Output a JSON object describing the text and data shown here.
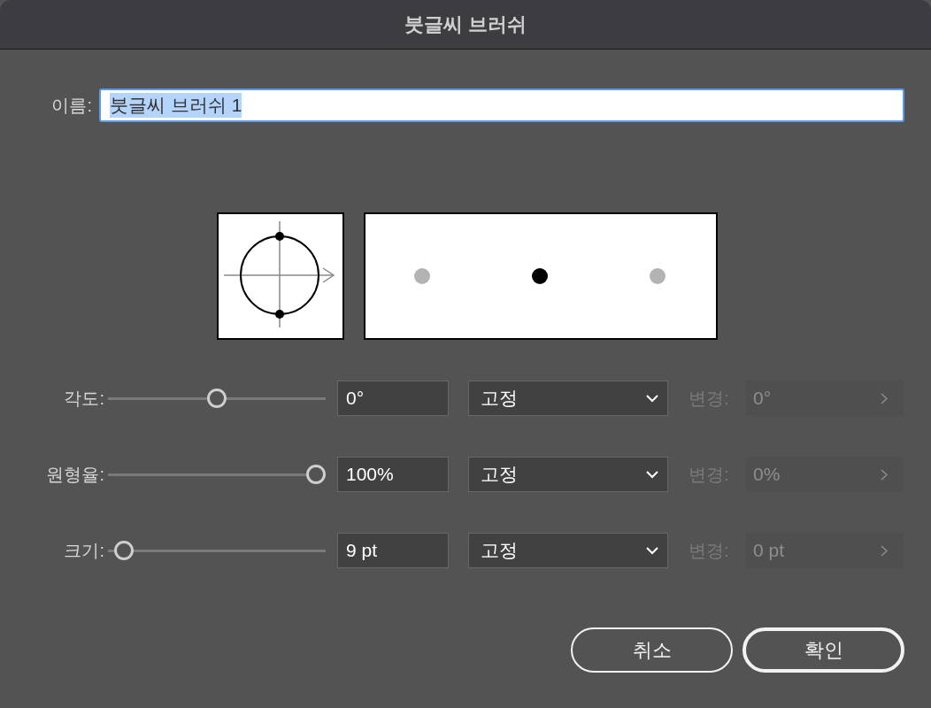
{
  "window": {
    "title": "붓글씨 브러쉬"
  },
  "name_field": {
    "label": "이름:",
    "value": "붓글씨 브러쉬 1",
    "text_selected": true
  },
  "parameters": [
    {
      "label": "각도:",
      "level": 0.5,
      "value": "0°",
      "mode": "고정",
      "variation_label": "변경:",
      "variation_value": "0°",
      "variation_disabled": true
    },
    {
      "label": "원형율:",
      "level": 1,
      "value": "100%",
      "mode": "고정",
      "variation_label": "변경:",
      "variation_value": "0%",
      "variation_disabled": true
    },
    {
      "label": "크기:",
      "level": 0.03,
      "value": "9 pt",
      "mode": "고정",
      "variation_label": "변경:",
      "variation_value": "0 pt",
      "variation_disabled": true
    }
  ],
  "buttons": [
    {
      "label": "취소",
      "default": false
    },
    {
      "label": "확인",
      "default": true
    }
  ]
}
